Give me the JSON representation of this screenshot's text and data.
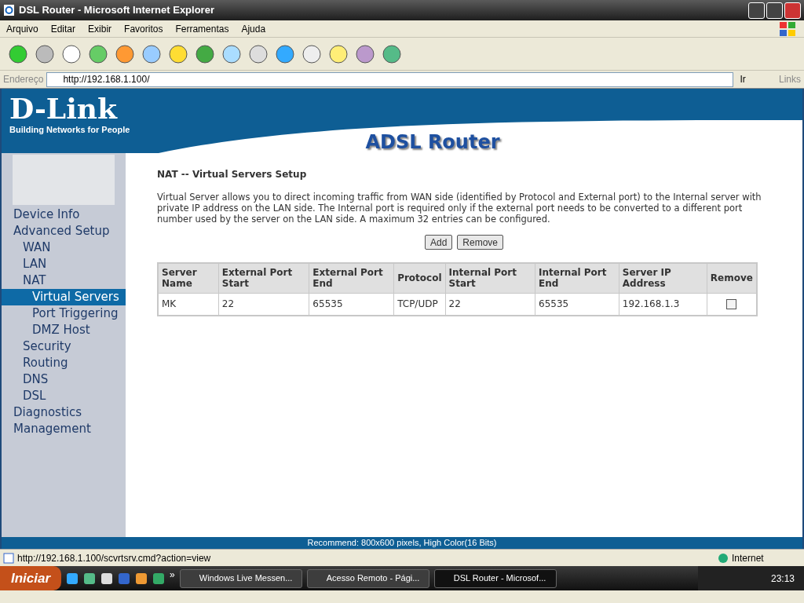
{
  "window": {
    "title": "DSL Router - Microsoft Internet Explorer"
  },
  "menu": [
    "Arquivo",
    "Editar",
    "Exibir",
    "Favoritos",
    "Ferramentas",
    "Ajuda"
  ],
  "address_bar": {
    "label": "Endereço",
    "value": "http://192.168.1.100/",
    "go": "Ir",
    "links": "Links"
  },
  "page": {
    "logo": "D-Link",
    "tagline": "Building Networks for People",
    "product": "ADSL Router",
    "sidebar": [
      {
        "label": "Device Info",
        "selected": false
      },
      {
        "label": "Advanced Setup",
        "selected": false,
        "children": [
          {
            "label": "WAN",
            "selected": false
          },
          {
            "label": "LAN",
            "selected": false
          },
          {
            "label": "NAT",
            "selected": false,
            "children": [
              {
                "label": "Virtual Servers",
                "selected": true
              },
              {
                "label": "Port Triggering",
                "selected": false
              },
              {
                "label": "DMZ Host",
                "selected": false
              }
            ]
          },
          {
            "label": "Security",
            "selected": false
          },
          {
            "label": "Routing",
            "selected": false
          },
          {
            "label": "DNS",
            "selected": false
          },
          {
            "label": "DSL",
            "selected": false
          }
        ]
      },
      {
        "label": "Diagnostics",
        "selected": false
      },
      {
        "label": "Management",
        "selected": false
      }
    ],
    "heading": "NAT -- Virtual Servers Setup",
    "description": "Virtual Server allows you to direct incoming traffic from WAN side (identified by Protocol and External port) to the Internal server with private IP address on the LAN side. The Internal port is required only if the external port needs to be converted to a different port number used by the server on the LAN side. A maximum 32 entries can be configured.",
    "buttons": [
      "Add",
      "Remove"
    ],
    "table": {
      "columns": [
        "Server Name",
        "External Port Start",
        "External Port End",
        "Protocol",
        "Internal Port Start",
        "Internal Port End",
        "Server IP Address",
        "Remove"
      ],
      "rows": [
        {
          "cells": [
            "MK",
            "22",
            "65535",
            "TCP/UDP",
            "22",
            "65535",
            "192.168.1.3"
          ],
          "remove_checked": false
        }
      ]
    },
    "footer": "Recommend: 800x600 pixels, High Color(16 Bits)"
  },
  "status_bar": {
    "url": "http://192.168.1.100/scvrtsrv.cmd?action=view",
    "zone": "Internet"
  },
  "taskbar": {
    "start": "Iniciar",
    "more": "»",
    "tasks": [
      {
        "label": "Windows Live Messen...",
        "selected": false
      },
      {
        "label": "Acesso Remoto - Pági...",
        "selected": false
      },
      {
        "label": "DSL Router - Microsof...",
        "selected": true
      }
    ],
    "clock": "23:13"
  }
}
